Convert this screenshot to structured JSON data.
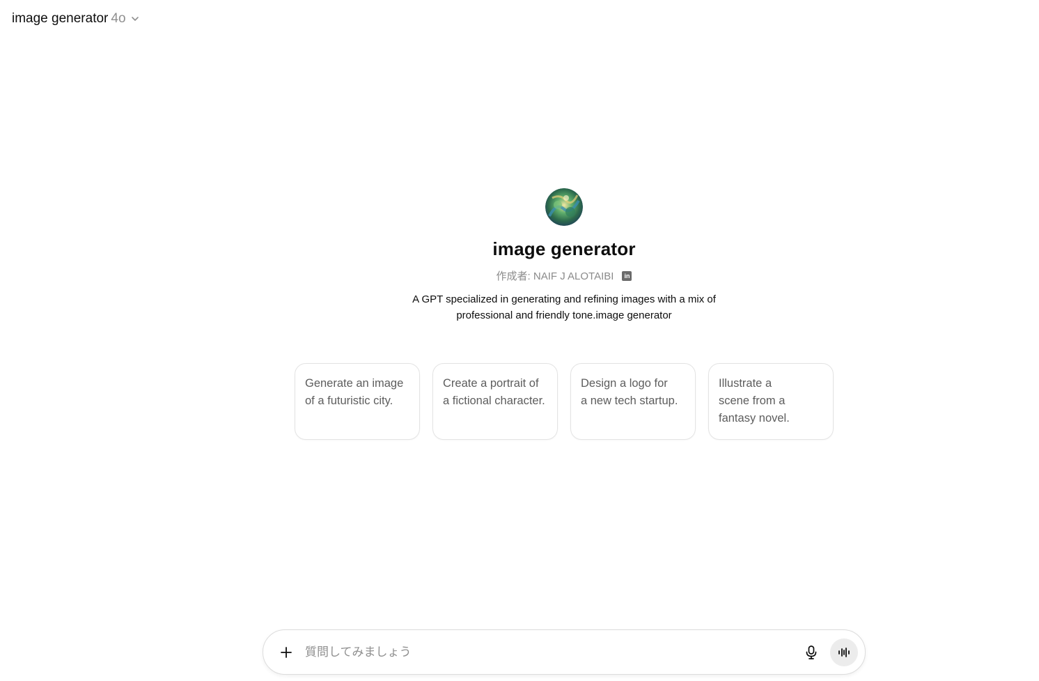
{
  "header": {
    "title": "image generator",
    "model": "4o"
  },
  "gpt": {
    "name": "image generator",
    "author": "作成者: NAIF J ALOTAIBI",
    "linkedin_label": "in",
    "description": "A GPT specialized in generating and refining images with a mix of professional and friendly tone.image generator"
  },
  "suggestions": [
    {
      "lines": [
        "Generate an image",
        "of a futuristic city."
      ]
    },
    {
      "lines": [
        "Create a portrait of",
        "a fictional character."
      ]
    },
    {
      "lines": [
        "Design a logo for",
        "a new tech startup."
      ]
    },
    {
      "lines": [
        "Illustrate a",
        "scene from a",
        "fantasy novel."
      ]
    }
  ],
  "composer": {
    "placeholder": "質問してみましょう"
  },
  "icons": {
    "plus": "plus-icon",
    "mic": "microphone-icon",
    "voice": "voice-mode-icon",
    "chevron": "chevron-down-icon",
    "linkedin": "linkedin-icon"
  }
}
